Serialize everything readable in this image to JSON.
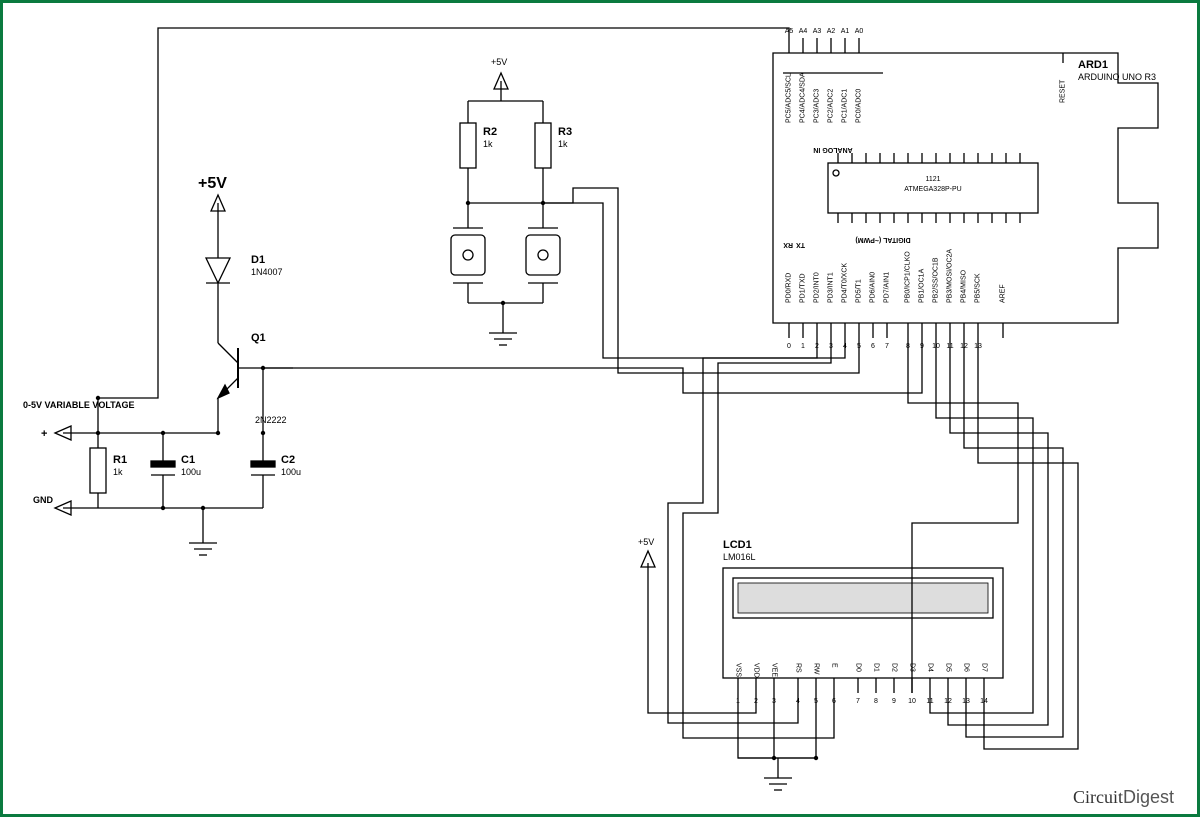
{
  "power": {
    "v5_big": "+5V",
    "v5_small": "+5V",
    "gnd": "GND",
    "var_label": "0-5V VARIABLE VOLTAGE",
    "plus": "+"
  },
  "components": {
    "D1": {
      "ref": "D1",
      "val": "1N4007"
    },
    "Q1": {
      "ref": "Q1",
      "val": "2N2222"
    },
    "R1": {
      "ref": "R1",
      "val": "1k"
    },
    "R2": {
      "ref": "R2",
      "val": "1k"
    },
    "R3": {
      "ref": "R3",
      "val": "1k"
    },
    "C1": {
      "ref": "C1",
      "val": "100u"
    },
    "C2": {
      "ref": "C2",
      "val": "100u"
    },
    "ARD": {
      "ref": "ARD1",
      "val": "ARDUINO UNO R3",
      "chip": "ATMEGA328P-PU",
      "chipnum": "1121"
    },
    "LCD": {
      "ref": "LCD1",
      "val": "LM016L"
    }
  },
  "arduino": {
    "analog_header": "ANALOG IN",
    "digital_header": "DIGITAL (~PWM)",
    "rx": "RX",
    "tx": "TX",
    "reset": "RESET",
    "analog_pins": [
      "A5",
      "A4",
      "A3",
      "A2",
      "A1",
      "A0"
    ],
    "analog_labels": [
      "PC5/ADC5/SCL",
      "PC4/ADC4/SDA",
      "PC3/ADC3",
      "PC2/ADC2",
      "PC1/ADC1",
      "PC0/ADC0"
    ],
    "digital_nums": [
      "0",
      "1",
      "2",
      "3",
      "4",
      "5",
      "6",
      "7",
      "8",
      "9",
      "10",
      "11",
      "12",
      "13"
    ],
    "digital_labels": [
      "PD0/RXD",
      "PD1/TXD",
      "PD2/INT0",
      "PD3/INT1",
      "PD4/T0/XCK",
      "PD5/T1",
      "PD6/AIN0",
      "PD7/AIN1",
      "PB0/ICP1/CLKO",
      "PB1/OC1A",
      "PB2/SS/OC1B",
      "PB3/MOSI/OC2A",
      "PB4/MISO",
      "PB5/SCK"
    ],
    "aref": "AREF"
  },
  "lcd": {
    "pin_names": [
      "VSS",
      "VDD",
      "VEE",
      "RS",
      "RW",
      "E",
      "D0",
      "D1",
      "D2",
      "D3",
      "D4",
      "D5",
      "D6",
      "D7"
    ],
    "pin_nums": [
      "1",
      "2",
      "3",
      "4",
      "5",
      "6",
      "7",
      "8",
      "9",
      "10",
      "11",
      "12",
      "13",
      "14"
    ]
  },
  "logo": {
    "a": "Circuit",
    "b": "Digest"
  }
}
